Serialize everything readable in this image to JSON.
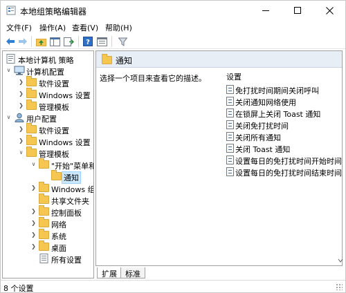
{
  "window": {
    "title": "本地组策略编辑器"
  },
  "menu": [
    "文件(F)",
    "操作(A)",
    "查看(V)",
    "帮助(H)"
  ],
  "toolbar": {
    "icons": [
      "back-icon",
      "forward-icon",
      "up-folder-icon",
      "show-hide-tree-icon",
      "export-list-icon",
      "help-icon",
      "properties-icon",
      "filter-icon"
    ]
  },
  "tree": {
    "root": "本地计算机 策略",
    "computer_config": "计算机配置",
    "cc_software": "软件设置",
    "cc_windows": "Windows 设置",
    "cc_admin": "管理模板",
    "user_config": "用户配置",
    "uc_software": "软件设置",
    "uc_windows": "Windows 设置",
    "uc_admin": "管理模板",
    "start_menu": "\"开始\"菜单和",
    "notify": "通知",
    "windows_comp": "Windows 组",
    "shared_folders": "共享文件夹",
    "control_panel": "控制面板",
    "network": "网络",
    "system": "系统",
    "desktop": "桌面",
    "all_settings": "所有设置"
  },
  "right": {
    "header": "通知",
    "description": "选择一个项目来查看它的描述。",
    "column": "设置",
    "settings": [
      "免打扰时间期间关闭呼叫",
      "关闭通知网络使用",
      "在锁屏上关闭 Toast 通知",
      "关闭免打扰时间",
      "关闭所有通知",
      "关闭 Toast 通知",
      "设置每日的免打扰时间开始时间",
      "设置每日的免打扰时间结束时间"
    ]
  },
  "tabs": [
    "扩展",
    "标准"
  ],
  "status": "8 个设置"
}
